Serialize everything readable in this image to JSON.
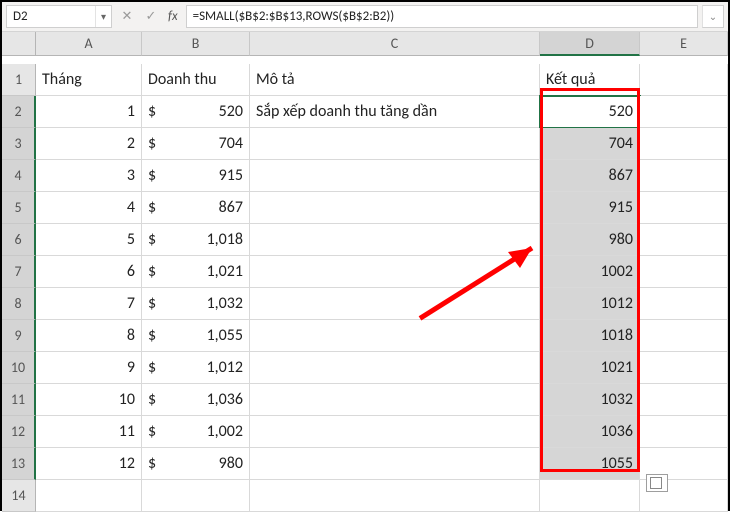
{
  "nameBox": "D2",
  "formula": "=SMALL($B$2:$B$13,ROWS($B$2:B2))",
  "columns": [
    "A",
    "B",
    "C",
    "D",
    "E"
  ],
  "selectedColumn": "D",
  "headers": {
    "A": "Tháng",
    "B": "Doanh thu",
    "C": "Mô tả",
    "D": "Kết quả"
  },
  "description": "Sắp xếp doanh thu tăng dần",
  "currency": "$",
  "rows": [
    {
      "n": 1,
      "thang": "1",
      "doanhthu": "520",
      "ketqua": "520"
    },
    {
      "n": 2,
      "thang": "2",
      "doanhthu": "704",
      "ketqua": "704"
    },
    {
      "n": 3,
      "thang": "3",
      "doanhthu": "915",
      "ketqua": "867"
    },
    {
      "n": 4,
      "thang": "4",
      "doanhthu": "867",
      "ketqua": "915"
    },
    {
      "n": 5,
      "thang": "5",
      "doanhthu": "1,018",
      "ketqua": "980"
    },
    {
      "n": 6,
      "thang": "6",
      "doanhthu": "1,021",
      "ketqua": "1002"
    },
    {
      "n": 7,
      "thang": "7",
      "doanhthu": "1,032",
      "ketqua": "1012"
    },
    {
      "n": 8,
      "thang": "8",
      "doanhthu": "1,055",
      "ketqua": "1018"
    },
    {
      "n": 9,
      "thang": "9",
      "doanhthu": "1,012",
      "ketqua": "1021"
    },
    {
      "n": 10,
      "thang": "10",
      "doanhthu": "1,036",
      "ketqua": "1032"
    },
    {
      "n": 11,
      "thang": "11",
      "doanhthu": "1,002",
      "ketqua": "1036"
    },
    {
      "n": 12,
      "thang": "12",
      "doanhthu": "980",
      "ketqua": "1055"
    }
  ],
  "lastRow": 14
}
